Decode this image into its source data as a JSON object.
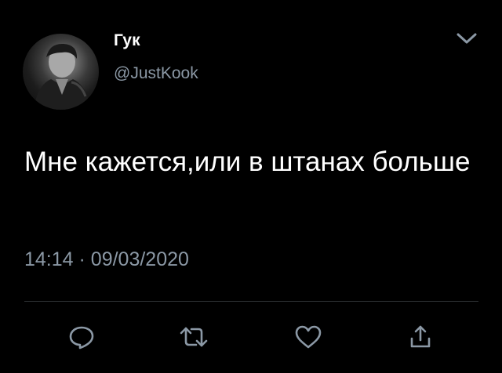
{
  "tweet": {
    "author_name": "Гук",
    "author_handle": "@JustKook",
    "text": "Мне кажется,или в штанах больше",
    "time": "14:14",
    "separator": "·",
    "date": "09/03/2020"
  },
  "icons": {
    "menu": "chevron-down-icon",
    "reply": "reply-icon",
    "retweet": "retweet-icon",
    "like": "heart-icon",
    "share": "share-icon"
  },
  "colors": {
    "background": "#000000",
    "text": "#ffffff",
    "secondary": "#8b98a5",
    "divider": "#2f3336"
  }
}
